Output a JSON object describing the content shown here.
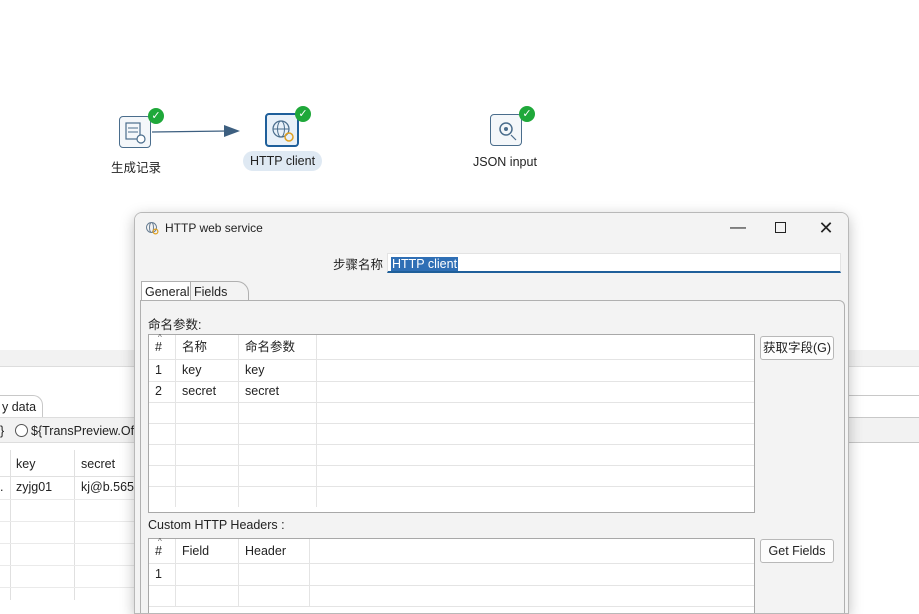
{
  "canvas": {
    "nodes": [
      {
        "label": "生成记录",
        "icon": "generate-rows-icon"
      },
      {
        "label": "HTTP client",
        "icon": "http-client-icon"
      },
      {
        "label": "JSON input",
        "icon": "json-input-icon"
      }
    ]
  },
  "preview_panel": {
    "tab_label": "y data",
    "option1_text": "}",
    "option2_text": "${TransPreview.Of",
    "columns": [
      "key",
      "secret"
    ],
    "rows": [
      {
        "prefix": ".",
        "key": "zyjg01",
        "secret": "kj@b.565"
      }
    ]
  },
  "dialog": {
    "title": "HTTP web service",
    "step_name_label": "步骤名称",
    "step_name_value": "HTTP client",
    "tabs": [
      "General",
      "Fields"
    ],
    "named_params_label": "命名参数:",
    "named_params_columns": [
      "#",
      "名称",
      "命名参数"
    ],
    "named_params_rows": [
      {
        "num": "1",
        "name": "key",
        "param": "key"
      },
      {
        "num": "2",
        "name": "secret",
        "param": "secret"
      }
    ],
    "get_fields_cn_label": "获取字段(G)",
    "headers_label": "Custom HTTP Headers :",
    "headers_columns": [
      "#",
      "Field",
      "Header"
    ],
    "headers_rows": [
      {
        "num": "1",
        "field": "",
        "header": ""
      }
    ],
    "get_fields_label": "Get Fields"
  },
  "colors": {
    "accent": "#1f5f9a",
    "ok_green": "#1fa83a",
    "selection": "#2f6fb5"
  }
}
